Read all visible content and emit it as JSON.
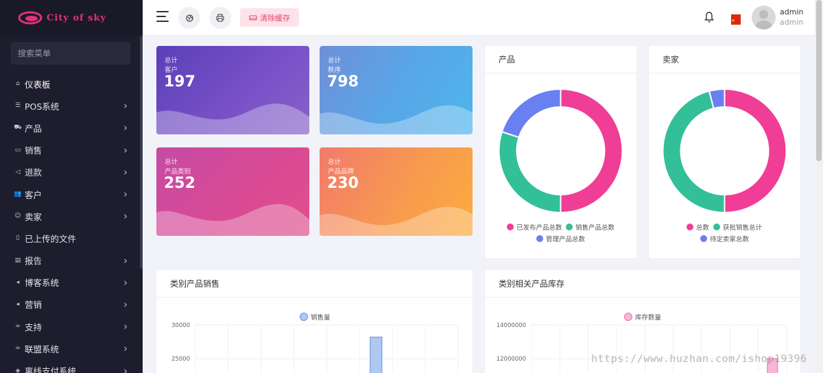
{
  "brand": {
    "name": "City of sky"
  },
  "sidebar": {
    "search_placeholder": "搜索菜单",
    "items": [
      {
        "label": "仪表板",
        "icon": "home-icon",
        "chevron": false
      },
      {
        "label": "POS系统",
        "icon": "list-icon",
        "chevron": true
      },
      {
        "label": "产品",
        "icon": "cart-icon",
        "chevron": true
      },
      {
        "label": "销售",
        "icon": "card-icon",
        "chevron": true
      },
      {
        "label": "退款",
        "icon": "refund-icon",
        "chevron": true
      },
      {
        "label": "客户",
        "icon": "users-icon",
        "chevron": true
      },
      {
        "label": "卖家",
        "icon": "user-icon",
        "chevron": true
      },
      {
        "label": "已上传的文件",
        "icon": "file-icon",
        "chevron": false
      },
      {
        "label": "报告",
        "icon": "report-icon",
        "chevron": true
      },
      {
        "label": "博客系统",
        "icon": "megaphone-icon",
        "chevron": true
      },
      {
        "label": "营销",
        "icon": "megaphone-icon",
        "chevron": true
      },
      {
        "label": "支持",
        "icon": "link-icon",
        "chevron": true
      },
      {
        "label": "联盟系统",
        "icon": "link-icon",
        "chevron": true
      },
      {
        "label": "离线支付系统",
        "icon": "pay-icon",
        "chevron": true
      }
    ]
  },
  "topbar": {
    "clear_cache_label": "清除缓存",
    "user_name": "admin",
    "user_role": "admin"
  },
  "stats": [
    {
      "label_top": "总计",
      "label_sub": "客户",
      "value": "197"
    },
    {
      "label_top": "总计",
      "label_sub": "秩序",
      "value": "798"
    },
    {
      "label_top": "总计",
      "label_sub": "产品类别",
      "value": "252"
    },
    {
      "label_top": "总计",
      "label_sub": "产品品牌",
      "value": "230"
    }
  ],
  "colors": {
    "pink": "#f03d95",
    "green": "#33bf98",
    "blue": "#6a7ff0"
  },
  "chart_data": [
    {
      "type": "pie",
      "title": "产品",
      "donut": true,
      "series": [
        {
          "name": "已发布产品总数",
          "value": 50
        },
        {
          "name": "销售产品总数",
          "value": 30
        },
        {
          "name": "管理产品总数",
          "value": 20
        }
      ]
    },
    {
      "type": "pie",
      "title": "卖家",
      "donut": true,
      "series": [
        {
          "name": "总数",
          "value": 50
        },
        {
          "name": "获批销售总计",
          "value": 46
        },
        {
          "name": "待定卖家总数",
          "value": 4
        }
      ]
    },
    {
      "type": "bar",
      "title": "类别产品销售",
      "legend": "销售量",
      "y_ticks": [
        "30000",
        "25000"
      ],
      "ylim": [
        20000,
        30000
      ],
      "visible_values": [
        0,
        0,
        0,
        0,
        0,
        28200,
        0,
        0
      ]
    },
    {
      "type": "bar",
      "title": "类别相关产品库存",
      "legend": "库存数量",
      "y_ticks": [
        "14000000",
        "12000000"
      ],
      "ylim": [
        10000000,
        14000000
      ],
      "visible_values": [
        0,
        0,
        0,
        0,
        0,
        0,
        0,
        0,
        12000000
      ]
    }
  ],
  "watermark": "https://www.huzhan.com/ishop19396"
}
